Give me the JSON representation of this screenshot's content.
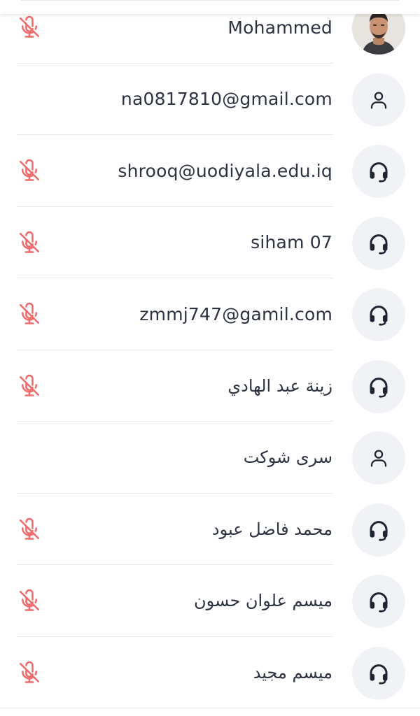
{
  "participants": [
    {
      "name": "Mohammed",
      "avatar": "photo",
      "mic_muted": true,
      "rtl": false
    },
    {
      "name": "na0817810@gmail.com",
      "avatar": "person-icon",
      "mic_muted": false,
      "rtl": false
    },
    {
      "name": "shrooq@uodiyala.edu.iq",
      "avatar": "headset-icon",
      "mic_muted": true,
      "rtl": false
    },
    {
      "name": "siham 07",
      "avatar": "headset-icon",
      "mic_muted": true,
      "rtl": false
    },
    {
      "name": "zmmj747@gamil.com",
      "avatar": "headset-icon",
      "mic_muted": true,
      "rtl": false
    },
    {
      "name": "زينة عبد الهادي",
      "avatar": "headset-icon",
      "mic_muted": true,
      "rtl": true
    },
    {
      "name": "سرى شوكت",
      "avatar": "person-icon",
      "mic_muted": false,
      "rtl": true
    },
    {
      "name": "محمد فاضل عبود",
      "avatar": "headset-icon",
      "mic_muted": true,
      "rtl": true
    },
    {
      "name": "ميسم علوان حسون",
      "avatar": "headset-icon",
      "mic_muted": true,
      "rtl": true
    },
    {
      "name": "ميسم مجيد",
      "avatar": "headset-icon",
      "mic_muted": true,
      "rtl": true
    }
  ],
  "colors": {
    "muted_mic": "#ef6b6b",
    "text": "#2c3240",
    "avatar_bg": "#f0f2f5",
    "icon": "#1e2433",
    "divider": "#e6e8ec"
  }
}
